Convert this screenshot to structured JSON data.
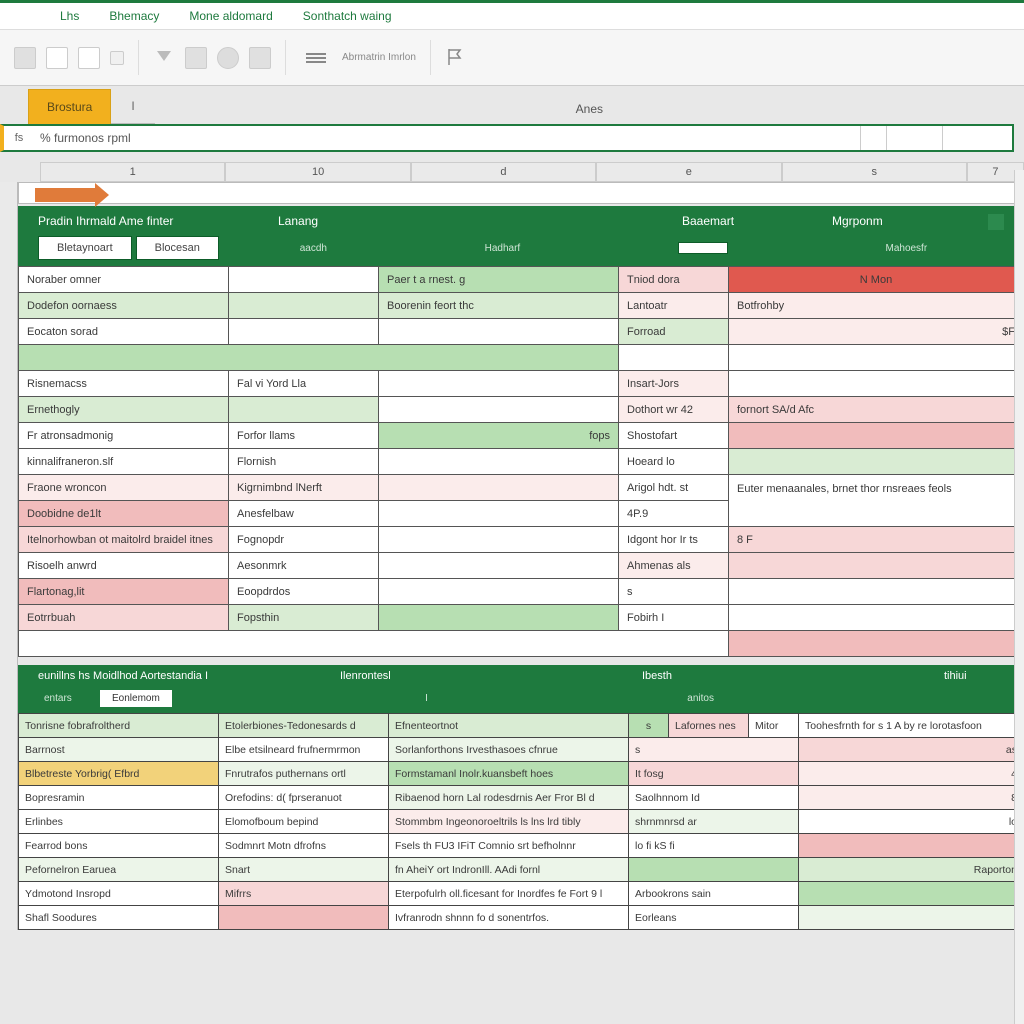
{
  "menu": {
    "m1": "Lhs",
    "m2": "Bhemacy",
    "m3": "Mone aldomard",
    "m4": "Sonthatch waing"
  },
  "ribbon": {
    "group_label": "Abrmatrin Imrlon"
  },
  "tabs": {
    "gold": "Brostura",
    "cell": "I",
    "center": "Anes"
  },
  "formula": {
    "fx": "fs",
    "text": "% furmonos rpml"
  },
  "cols": {
    "a": "1",
    "b": "10",
    "c": "d",
    "d": "e",
    "e": "s",
    "f": "7"
  },
  "header1": {
    "title": "Pradin Ihrmald Ame finter",
    "h2": "Lanang",
    "h3": "Baaemart",
    "h4": "Mgrponm"
  },
  "subtabs": {
    "t1": "Bletaynoart",
    "t2": "Blocesan",
    "s1": "aacdh",
    "s2": "Hadharf",
    "s3": "Mahoesfr"
  },
  "t1": {
    "r0a": "Noraber omner",
    "r0c": "Paer t a rnest. g",
    "r0d": "Tniod dora",
    "r0e": "N Mon",
    "r1a": "Dodefon oornaess",
    "r1c": "Boorenin feort thc",
    "r1d": "Lantoatr",
    "r1e": "Botfrohby",
    "r2a": "Eocaton sorad",
    "r2d": "Forroad",
    "r2e": "$F",
    "r3a": "Risnemacss",
    "r3b": "Fal vi  Yord Lla",
    "r3d": "Insart-Jors",
    "r4a": "Ernethogly",
    "r4d": "Dothort wr  42",
    "r4e": "fornort SA/d Afc",
    "r5a": "Fr atronsadmonig",
    "r5b": "Forfor llams",
    "r5c": "fops",
    "r5d": "Shostofart",
    "r6a": "kinnalifraneron.slf",
    "r6b": "Flornish",
    "r6d": "Hoeard lo",
    "r7a": "Fraone wroncon",
    "r7b": "Kigrnimbnd lNerft",
    "r7d": "Arigol hdt.   st",
    "r8a": "Doobidne de1lt",
    "r8b": "Anesfelbaw",
    "r8d": "4P.9",
    "r8e": "Euter menaanales, brnet thor rnsreaes feols",
    "r9a": "Itelnorhowban ot maitolrd braidel itnes",
    "r9b": "Fognopdr",
    "r9d": "Idgont  hor Ir ts",
    "r9e": "8 F",
    "r10a": "Risoelh anwrd",
    "r10b": "Aesonmrk",
    "r10d": "Ahmenas als",
    "r11a": "Flartonag,lit",
    "r11b": "Eoopdrdos",
    "r11d": "s",
    "r12a": "Eotrrbuah",
    "r12b": "Fopsthin",
    "r12d": "Fobirh I"
  },
  "header2": {
    "title": "eunillns hs Moidlhod Aortestandia I",
    "h2": "Ilenrontesl",
    "h3": "Ibesth",
    "h4": "tihiui"
  },
  "sub2": {
    "s1": "entars",
    "s2": "Eonlemom",
    "seg1": "",
    "seg2": "I",
    "seg3": "anitos"
  },
  "t2": {
    "r0a": "Tonrisne fobrafroltherd",
    "r0b": "Etolerbiones-Tedonesards d",
    "r0c": "Efnenteortnot",
    "r0d": "s",
    "r0da": "Lafornes nes",
    "r0db": "Mitor",
    "r0e": "Toohesfrnth for s  1 A by re lorotasfoon",
    "r1a": "Barrnost",
    "r1b": "Elbe etsilneard  frufnermrmon",
    "r1c": "Sorlanforthons Irvesthasoes cfnrue",
    "r1d": "s",
    "r1e": "as",
    "r2a": "Blbetreste Yorbrig( Efbrd",
    "r2b": "Fnrutrafos  puthernans  ortl",
    "r2c": "Formstamanl  Inolr.kuansbeft hoes",
    "r2d": "It fosg",
    "r2e": "4",
    "r3a": "Bopresramin",
    "r3b": "Orefodins: d(  fprseranuot",
    "r3c": "Ribaenod horn Lal rodesdrnis  Aer Fror  Bl d",
    "r3d": "Saolhnnom  Id",
    "r3e": "8",
    "r4a": "Erlinbes",
    "r4b": "Elomofboum bepind",
    "r4c": "Stommbm Ingeonoroeltrils ls lns  lrd tibly",
    "r4d": "shrnmnrsd ar",
    "r4e": "lo",
    "r5a": "Fearrod bons",
    "r5b": "Sodmnrt Motn dfrofns",
    "r5c": "Fsels th FU3 IFiT Comnio srt befholnnr",
    "r5d": "lo fi kS fi",
    "r5e": "",
    "r6a": "Pefornelron Earuea",
    "r6b": "Snart",
    "r6c": "fn  AheiY ort IndronIll. AAdi fornl",
    "r6d": "",
    "r6e": "Raporton",
    "r7a": "Ydmotond Insropd",
    "r7b": "Mifrrs",
    "r7c": "Eterpofulrh oll.ficesant for Inordfes fe Fort 9 l",
    "r7d": "Arbookrons  sain",
    "r7e": "",
    "r8a": "Shafl Soodures",
    "r8b": "",
    "r8c": "Ivfranrodn shnnn fo d sonentrfos.",
    "r8d": "Eorleans",
    "r8e": ""
  }
}
